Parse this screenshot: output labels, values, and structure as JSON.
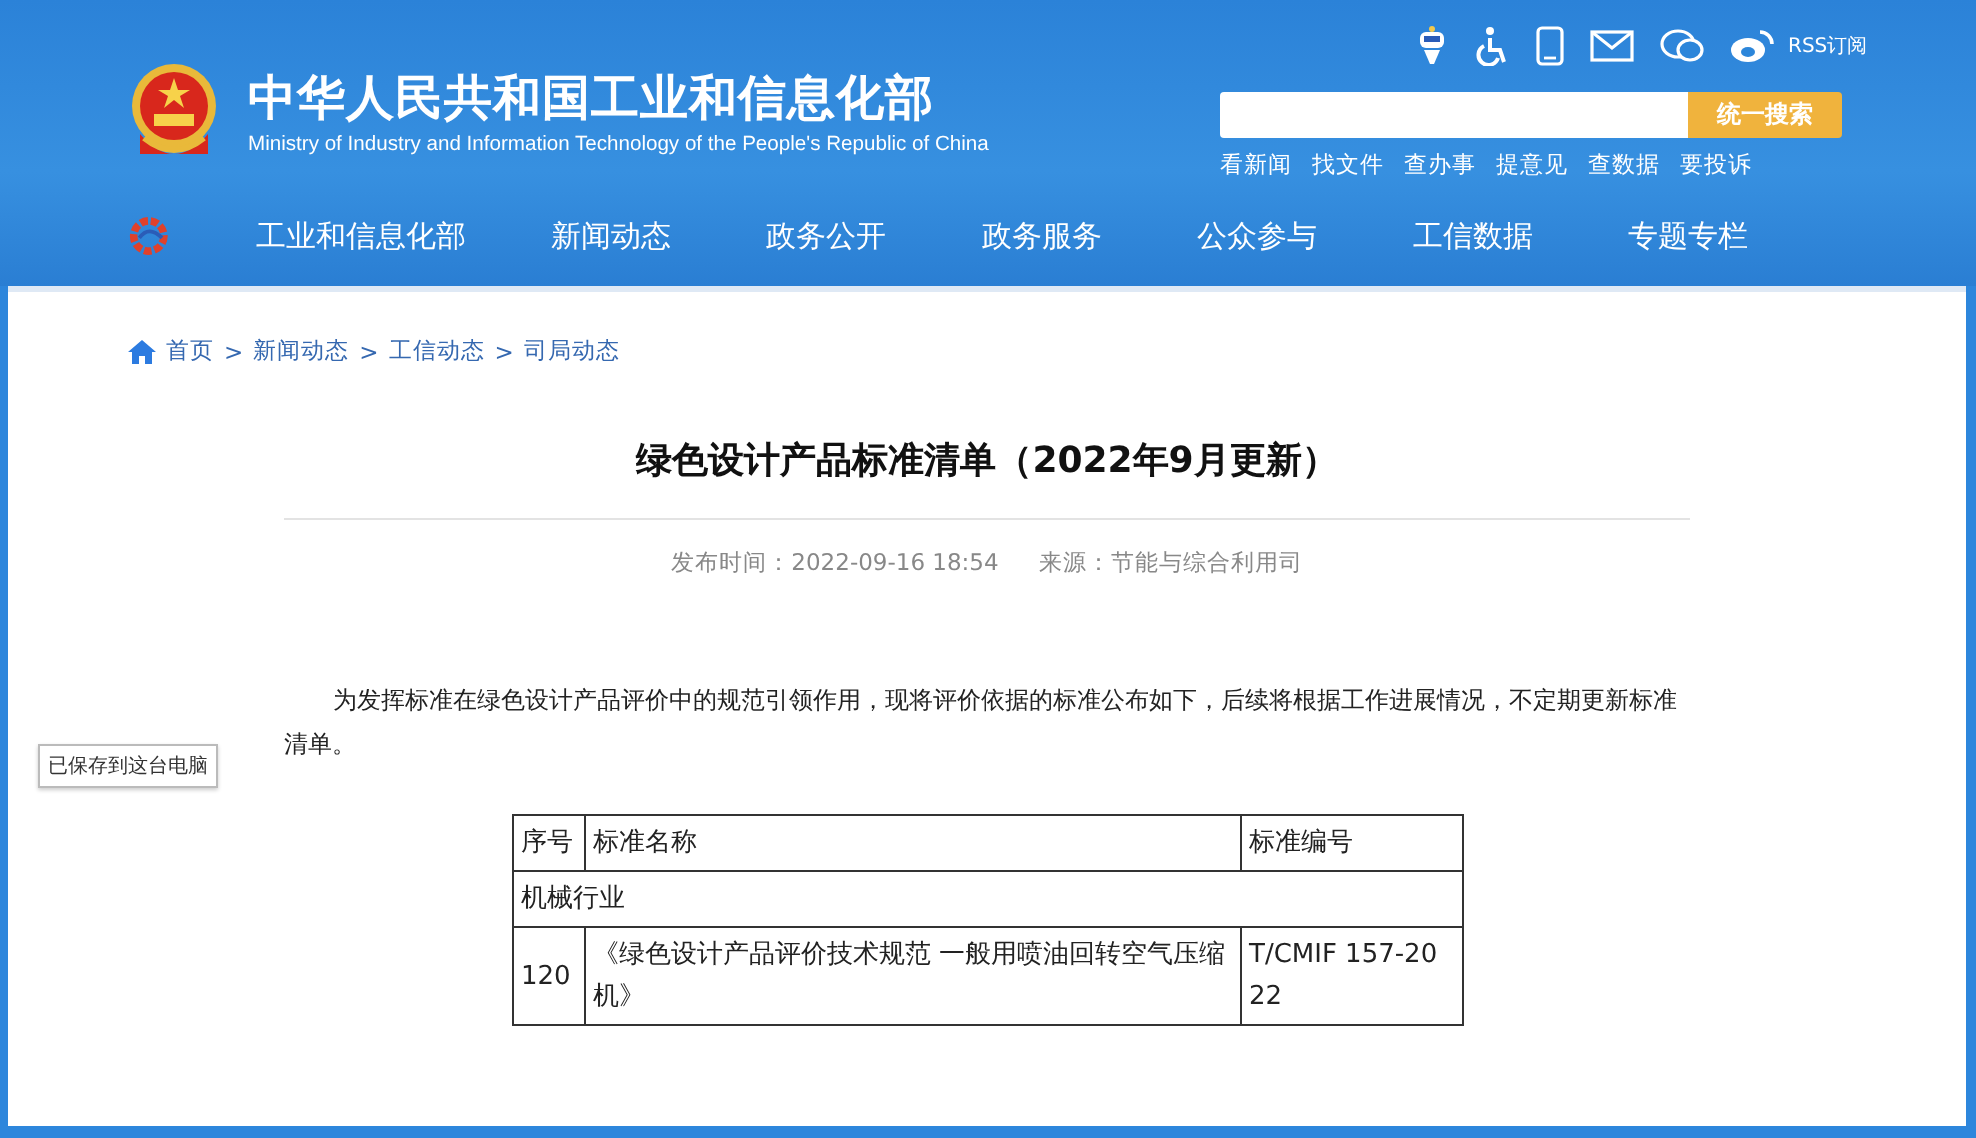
{
  "header": {
    "title": "中华人民共和国工业和信息化部",
    "subtitle": "Ministry of Industry and Information Technology of the People's Republic of China",
    "rss": "RSS订阅",
    "search": {
      "button": "统一搜索"
    },
    "quick_links": [
      "看新闻",
      "找文件",
      "查办事",
      "提意见",
      "查数据",
      "要投诉"
    ],
    "nav": [
      "工业和信息化部",
      "新闻动态",
      "政务公开",
      "政务服务",
      "公众参与",
      "工信数据",
      "专题专栏"
    ]
  },
  "breadcrumb": {
    "separator": ">",
    "items": [
      "首页",
      "新闻动态",
      "工信动态",
      "司局动态"
    ]
  },
  "article": {
    "title": "绿色设计产品标准清单（2022年9月更新）",
    "published": "发布时间：2022-09-16 18:54",
    "source": "来源：节能与综合利用司",
    "paragraph": "为发挥标准在绿色设计产品评价中的规范引领作用，现将评价依据的标准公布如下，后续将根据工作进展情况，不定期更新标准清单。"
  },
  "saved_badge": "已保存到这台电脑",
  "table": {
    "columns": [
      "序号",
      "标准名称",
      "标准编号"
    ],
    "rows": [
      {
        "kind": "section",
        "label": "机械行业"
      },
      {
        "kind": "item",
        "cells": [
          "120",
          "《绿色设计产品评价技术规范 一般用喷油回转空气压缩机》",
          "T/CMIF 157-2022"
        ]
      }
    ]
  }
}
